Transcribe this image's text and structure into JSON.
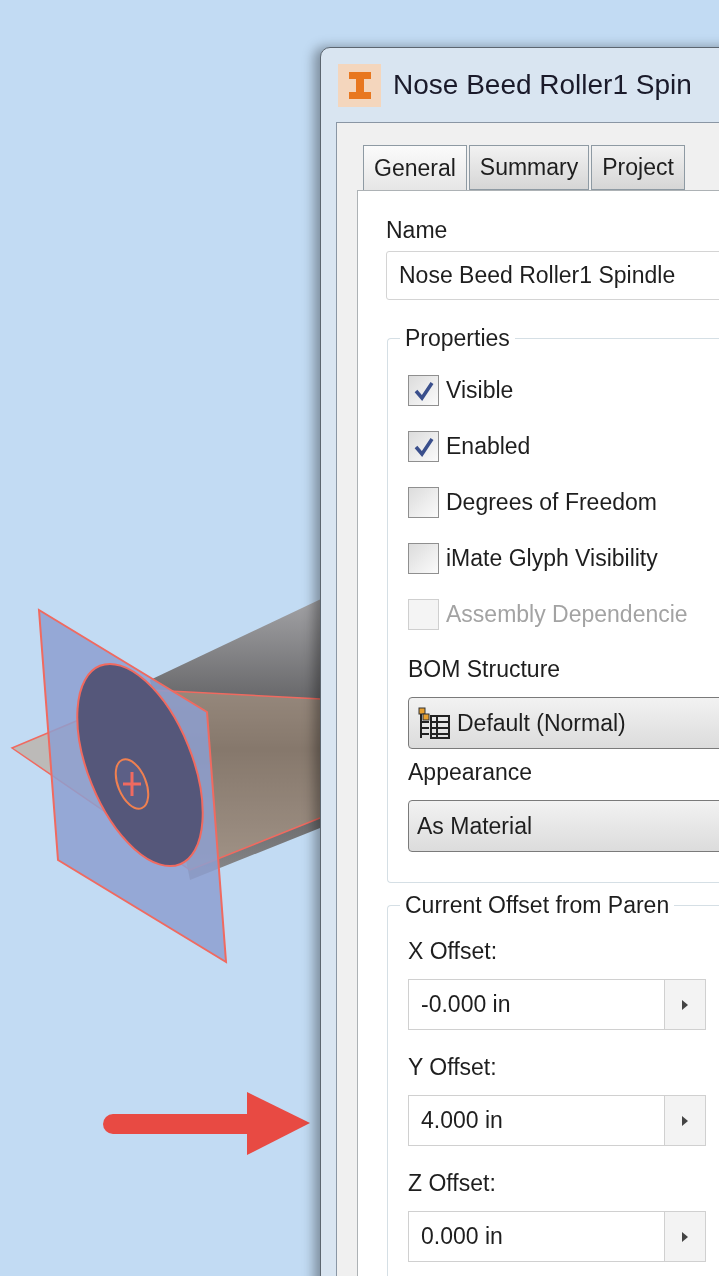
{
  "window": {
    "title": "Nose Beed Roller1 Spin"
  },
  "tabs": [
    {
      "label": "General",
      "selected": true
    },
    {
      "label": "Summary",
      "selected": false
    },
    {
      "label": "Project",
      "selected": false
    }
  ],
  "name_field": {
    "label": "Name",
    "value": "Nose Beed Roller1 Spindle"
  },
  "properties": {
    "title": "Properties",
    "checkboxes": [
      {
        "label": "Visible",
        "checked": true,
        "disabled": false
      },
      {
        "label": "Enabled",
        "checked": true,
        "disabled": false
      },
      {
        "label": "Degrees of Freedom",
        "checked": false,
        "disabled": false
      },
      {
        "label": "iMate Glyph Visibility",
        "checked": false,
        "disabled": false
      },
      {
        "label": "Assembly Dependencie",
        "checked": false,
        "disabled": true
      }
    ],
    "dropdowns": [
      {
        "label": "BOM Structure",
        "value": "Default (Normal)",
        "kind": "structure"
      },
      {
        "label": "Appearance",
        "value": "As Material",
        "kind": "plain"
      }
    ]
  },
  "offsets": {
    "title": "Current Offset from Paren",
    "fields": [
      {
        "label": "X Offset:",
        "value": "-0.000 in"
      },
      {
        "label": "Y Offset:",
        "value": "4.000 in"
      },
      {
        "label": "Z Offset:",
        "value": "0.000 in"
      }
    ]
  }
}
